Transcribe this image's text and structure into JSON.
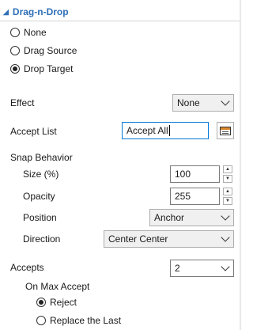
{
  "header": {
    "title": "Drag-n-Drop"
  },
  "mode_options": [
    {
      "label": "None",
      "checked": false
    },
    {
      "label": "Drag Source",
      "checked": false
    },
    {
      "label": "Drop Target",
      "checked": true
    }
  ],
  "effect": {
    "label": "Effect",
    "value": "None"
  },
  "accept_list": {
    "label": "Accept List",
    "value": "Accept All"
  },
  "snap": {
    "section_label": "Snap Behavior",
    "size_label": "Size (%)",
    "size_value": "100",
    "opacity_label": "Opacity",
    "opacity_value": "255",
    "position_label": "Position",
    "position_value": "Anchor",
    "direction_label": "Direction",
    "direction_value": "Center Center"
  },
  "accepts": {
    "label": "Accepts",
    "value": "2"
  },
  "max_accept": {
    "label": "On Max Accept",
    "options": [
      {
        "label": "Reject",
        "checked": true
      },
      {
        "label": "Replace the Last",
        "checked": false
      }
    ]
  }
}
